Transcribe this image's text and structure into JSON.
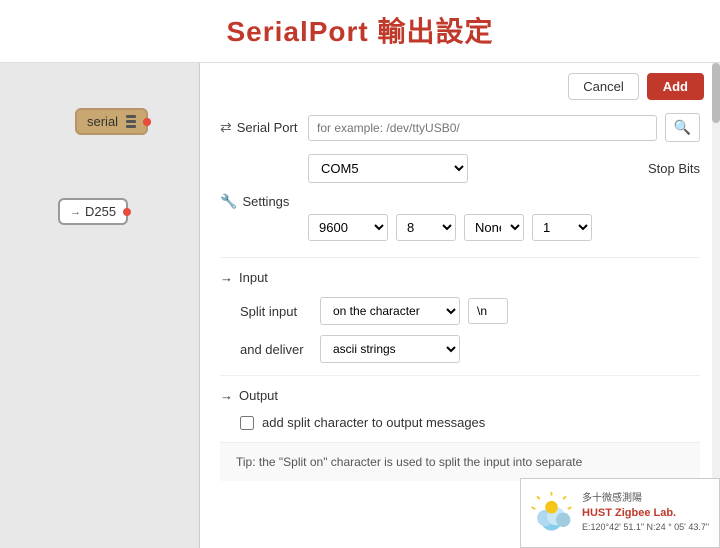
{
  "title": {
    "text": "SerialPort  輸出設定"
  },
  "dialog": {
    "cancel_label": "Cancel",
    "add_label": "Add"
  },
  "serial_port_section": {
    "label": "Serial Port",
    "placeholder": "for example: /dev/ttyUSB0/",
    "com_value": "COM5",
    "stop_bits_label": "Stop Bits"
  },
  "settings_section": {
    "label": "Settings",
    "baud_rate": "9600",
    "data_bits": "8",
    "parity": "None",
    "stop_bits": "1"
  },
  "input_section": {
    "label": "Input",
    "split_input_label": "Split input",
    "split_value": "on the character",
    "char_value": "\\n",
    "deliver_label": "and deliver",
    "deliver_value": "ascii strings"
  },
  "output_section": {
    "label": "Output",
    "checkbox_label": "add split character to output messages",
    "checkbox_checked": false
  },
  "tip": {
    "text": "Tip: the \"Split on\" character is used to split the input into separate"
  },
  "watermark": {
    "lab_name": "HUST Zigbee Lab.",
    "coords": "E:120°42' 51.1\"  N:24 ° 05' 43.7\""
  },
  "nodes": {
    "serial_label": "serial",
    "d255_label": "D255"
  }
}
